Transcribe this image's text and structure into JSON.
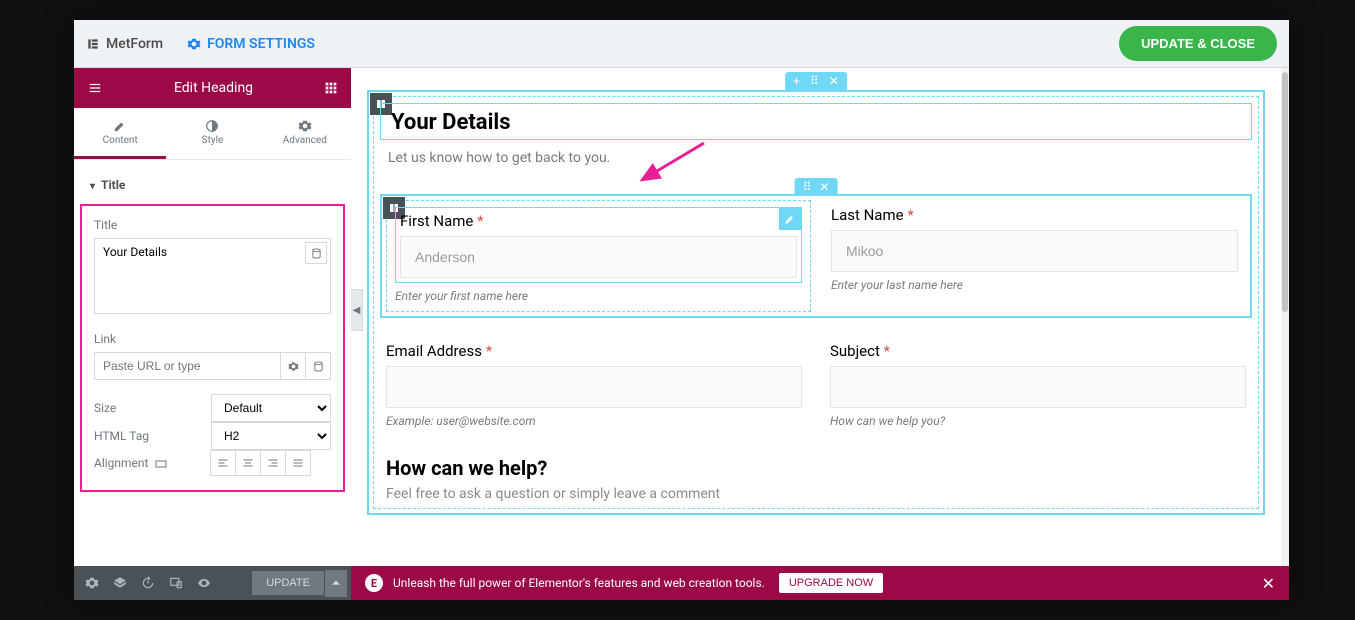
{
  "topbar": {
    "logo": "MetForm",
    "form_settings": "FORM SETTINGS",
    "update_close": "UPDATE & CLOSE"
  },
  "sidebar": {
    "header_title": "Edit Heading",
    "tabs": {
      "content": "Content",
      "style": "Style",
      "advanced": "Advanced"
    },
    "section_title": "Title",
    "controls": {
      "title_label": "Title",
      "title_value": "Your Details",
      "link_label": "Link",
      "link_placeholder": "Paste URL or type",
      "size_label": "Size",
      "size_value": "Default",
      "htmltag_label": "HTML Tag",
      "htmltag_value": "H2",
      "alignment_label": "Alignment"
    },
    "footer": {
      "update": "UPDATE"
    }
  },
  "canvas": {
    "main_heading": "Your Details",
    "main_sub": "Let us know how to get back to you.",
    "first_name": {
      "label": "First Name",
      "placeholder": "Anderson",
      "help": "Enter your first name here"
    },
    "last_name": {
      "label": "Last Name",
      "placeholder": "Mikoo",
      "help": "Enter your last name here"
    },
    "email": {
      "label": "Email Address",
      "help": "Example: user@website.com"
    },
    "subject": {
      "label": "Subject",
      "help": "How can we help you?"
    },
    "help_head": "How can we help?",
    "help_sub": "Feel free to ask a question or simply leave a comment"
  },
  "promo": {
    "text": "Unleash the full power of Elementor's features and web creation tools.",
    "upgrade": "UPGRADE NOW"
  }
}
